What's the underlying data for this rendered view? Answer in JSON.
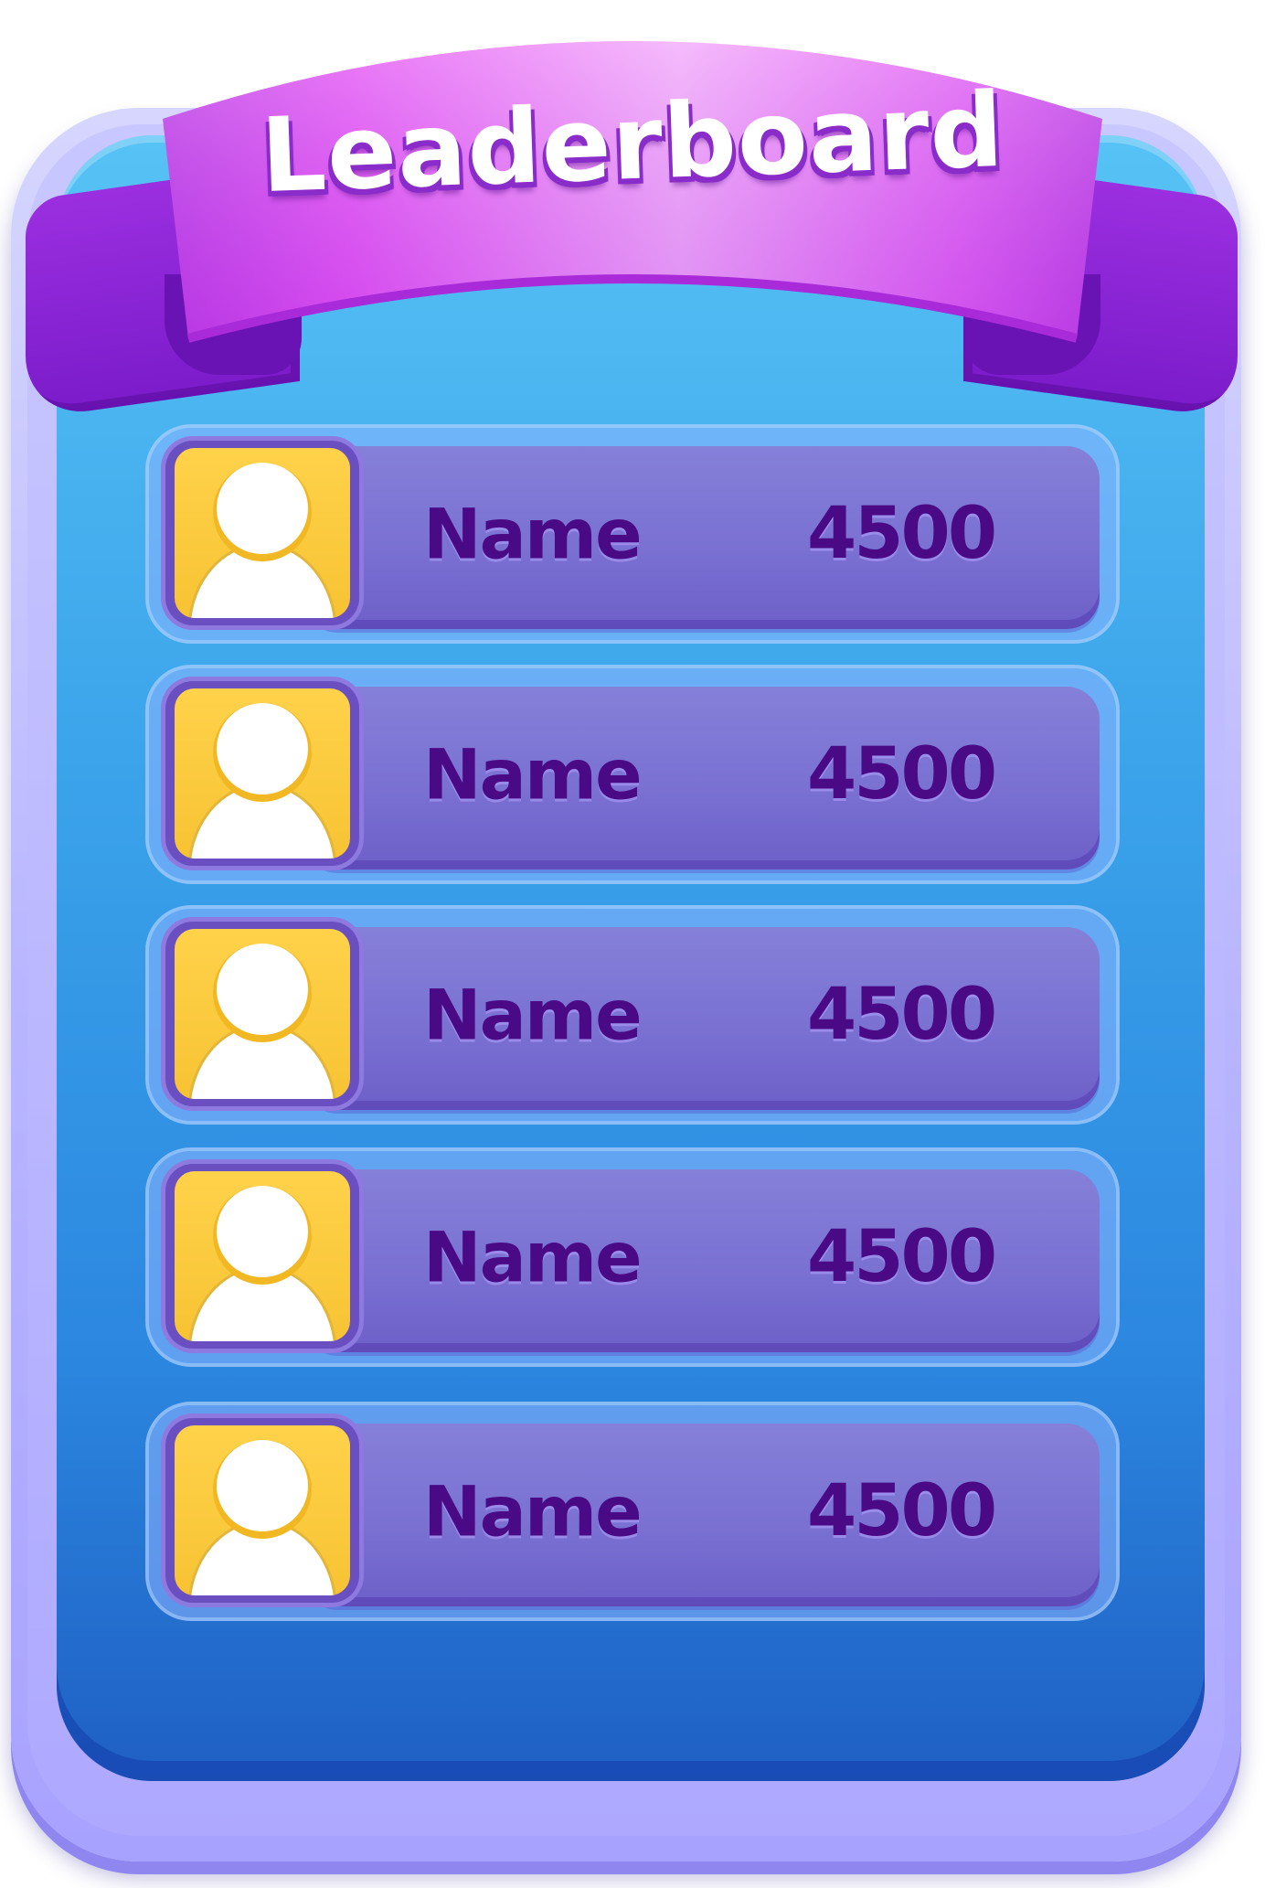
{
  "title": "Leaderboard",
  "colors": {
    "panel": "#3aa2ea",
    "frame": "#b9b6ff",
    "ribbon": "#e56ef5",
    "row_bar": "#7a71d3",
    "avatar_bg": "#f7c333",
    "text": "#4a0a86"
  },
  "rows": [
    {
      "name": "Name",
      "score": "4500",
      "avatar_icon": "user-avatar-icon"
    },
    {
      "name": "Name",
      "score": "4500",
      "avatar_icon": "user-avatar-icon"
    },
    {
      "name": "Name",
      "score": "4500",
      "avatar_icon": "user-avatar-icon"
    },
    {
      "name": "Name",
      "score": "4500",
      "avatar_icon": "user-avatar-icon"
    },
    {
      "name": "Name",
      "score": "4500",
      "avatar_icon": "user-avatar-icon"
    }
  ]
}
